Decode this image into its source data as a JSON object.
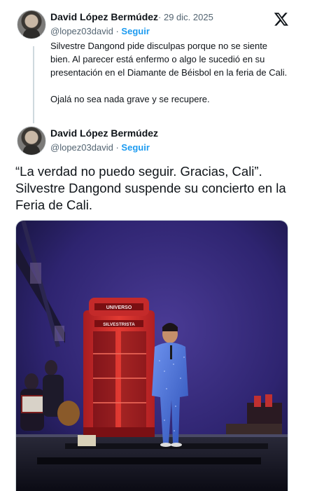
{
  "reply_tweet": {
    "author": "David López Bermúdez",
    "date": "29 dic. 2025",
    "handle": "@lopez03david",
    "follow_label": "Seguir",
    "paragraphs": [
      "Silvestre Dangond pide disculpas porque no se siente bien. Al parecer está enfermo o algo le sucedió en su presentación en el Diamante de Béisbol en la feria de Cali.",
      "Ojalá no sea nada grave y se recupere."
    ]
  },
  "quoted_tweet": {
    "author": "David López Bermúdez",
    "handle": "@lopez03david",
    "follow_label": "Seguir",
    "text": "“La verdad no puedo seguir. Gracias, Cali”. Silvestre Dangond suspende su concierto en la Feria de Cali."
  },
  "photo": {
    "booth_sign_top": "UNIVERSO",
    "booth_sign_bottom": "SILVESTRISTA",
    "colors": {
      "stage_bg": "#3b2f7e",
      "booth_red": "#d62a2a",
      "suit_blue": "#4a70d8"
    }
  },
  "icons": {
    "platform": "x-logo-icon"
  },
  "separator": "·"
}
